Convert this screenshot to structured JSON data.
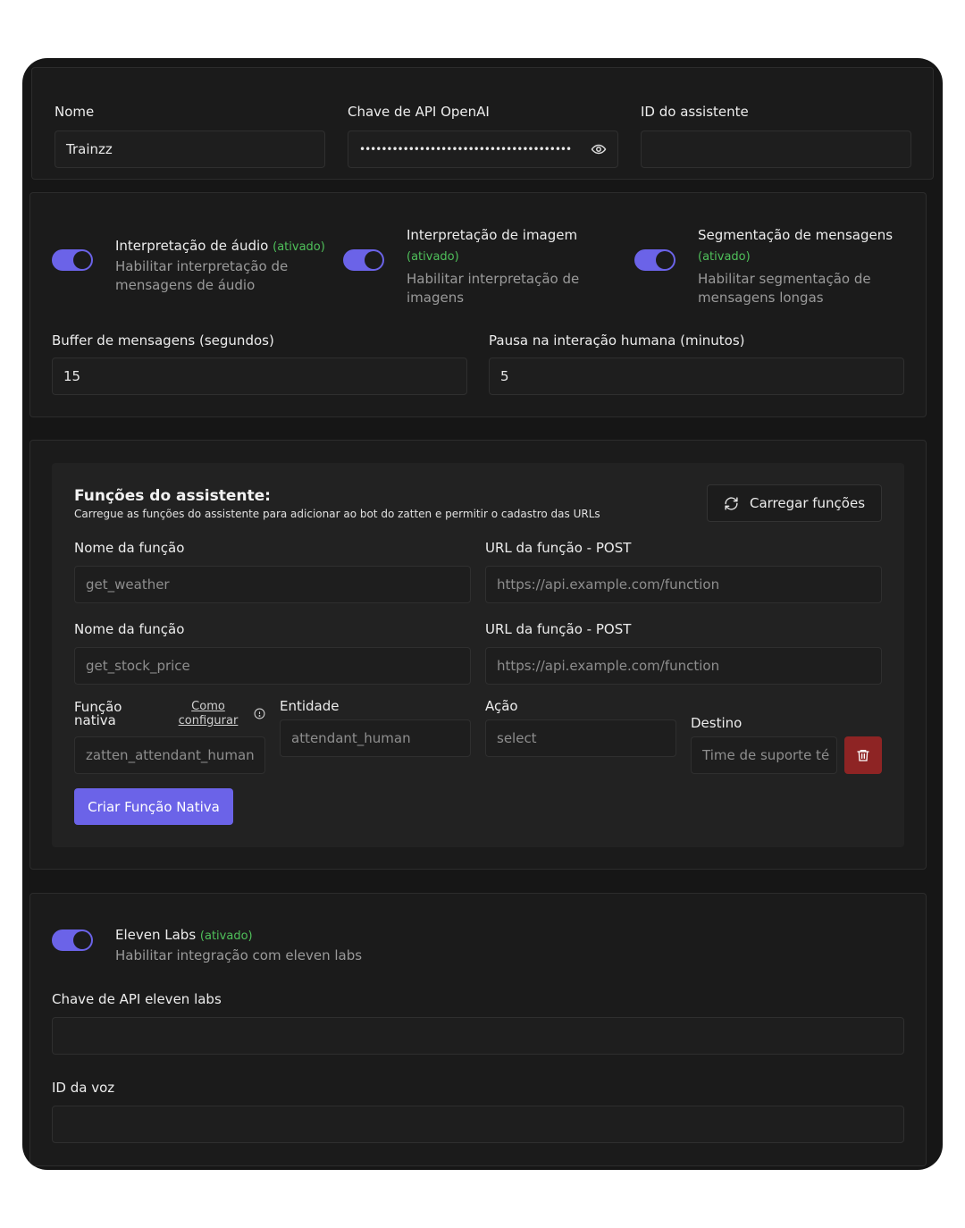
{
  "account": {
    "name_label": "Nome",
    "name_value": "Trainzz",
    "api_key_label": "Chave de API OpenAI",
    "api_key_value": "•••••••••••••••••••••••••••••••••••••••",
    "assistant_id_label": "ID do assistente",
    "assistant_id_value": ""
  },
  "options": {
    "audio": {
      "title": "Interpretação de áudio",
      "status": "(ativado)",
      "desc": "Habilitar interpretação de mensagens de áudio",
      "enabled": true
    },
    "image": {
      "title": "Interpretação de imagem",
      "status": "(ativado)",
      "desc": "Habilitar interpretação de imagens",
      "enabled": true
    },
    "segmentation": {
      "title": "Segmentação de mensagens",
      "status": "(ativado)",
      "desc": "Habilitar segmentação de mensagens longas",
      "enabled": true
    },
    "buffer_label": "Buffer de mensagens (segundos)",
    "buffer_value": "15",
    "pause_label": "Pausa na interação humana (minutos)",
    "pause_value": "5"
  },
  "functions": {
    "title": "Funções do assistente:",
    "subtitle": "Carregue as funções do assistente para adicionar ao bot do zatten e permitir o cadastro das URLs",
    "load_button": "Carregar funções",
    "rows": [
      {
        "name_label": "Nome da função",
        "name_value": "get_weather",
        "url_label": "URL da função - POST",
        "url_value": "https://api.example.com/function"
      },
      {
        "name_label": "Nome da função",
        "name_value": "get_stock_price",
        "url_label": "URL da função - POST",
        "url_value": "https://api.example.com/function"
      }
    ],
    "native": {
      "label": "Função nativa",
      "how_to_link": "Como configurar",
      "value": "zatten_attendant_human",
      "entity_label": "Entidade",
      "entity_value": "attendant_human",
      "action_label": "Ação",
      "action_value": "select",
      "target_label": "Destino",
      "target_value": "Time de suporte té"
    },
    "create_button": "Criar Função Nativa"
  },
  "eleven": {
    "title": "Eleven Labs",
    "status": "(ativado)",
    "desc": "Habilitar integração com eleven labs",
    "enabled": true,
    "api_key_label": "Chave de API eleven labs",
    "api_key_value": "",
    "voice_id_label": "ID da voz",
    "voice_id_value": ""
  },
  "colors": {
    "accent": "#6b63e8",
    "status_green": "#4fc05a",
    "danger": "#8e2424",
    "panel": "#1b1b1b"
  }
}
